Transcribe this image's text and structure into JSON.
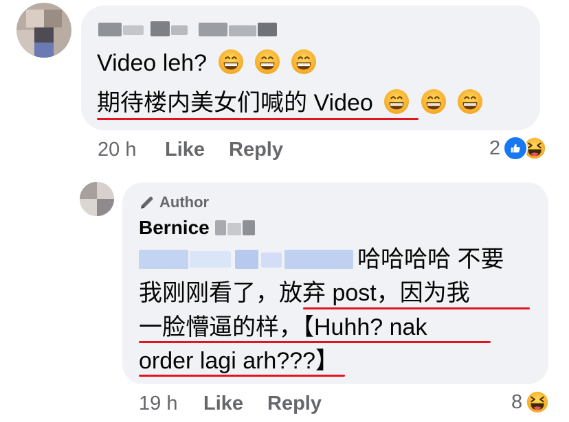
{
  "comment": {
    "author_name_redacted": true,
    "line1": "Video leh?",
    "line2": "期待楼内美女们喊的 Video",
    "time": "20 h",
    "like_label": "Like",
    "reply_label": "Reply",
    "reaction_count": "2",
    "reaction_icons": [
      "like-icon",
      "haha-icon"
    ]
  },
  "reply": {
    "badge_label": "Author",
    "author_name": "Bernice",
    "line1_text": "哈哈哈哈 不要",
    "line2_a": "我刚刚看了，",
    "line2_b": "放弃 post，因为我",
    "line3_a": "一脸懵逼的样，",
    "line3_b": "【Huhh? nak",
    "line4": "order lagi arh???】",
    "time": "19 h",
    "like_label": "Like",
    "reply_label": "Reply",
    "reaction_count": "8",
    "reaction_icons": [
      "haha-icon"
    ]
  },
  "colors": {
    "bubble": "#f0f2f5",
    "meta_text": "#65676b",
    "underline": "#e4141e",
    "like_blue": "#1877f2",
    "haha_yellow": "#f7b125"
  }
}
